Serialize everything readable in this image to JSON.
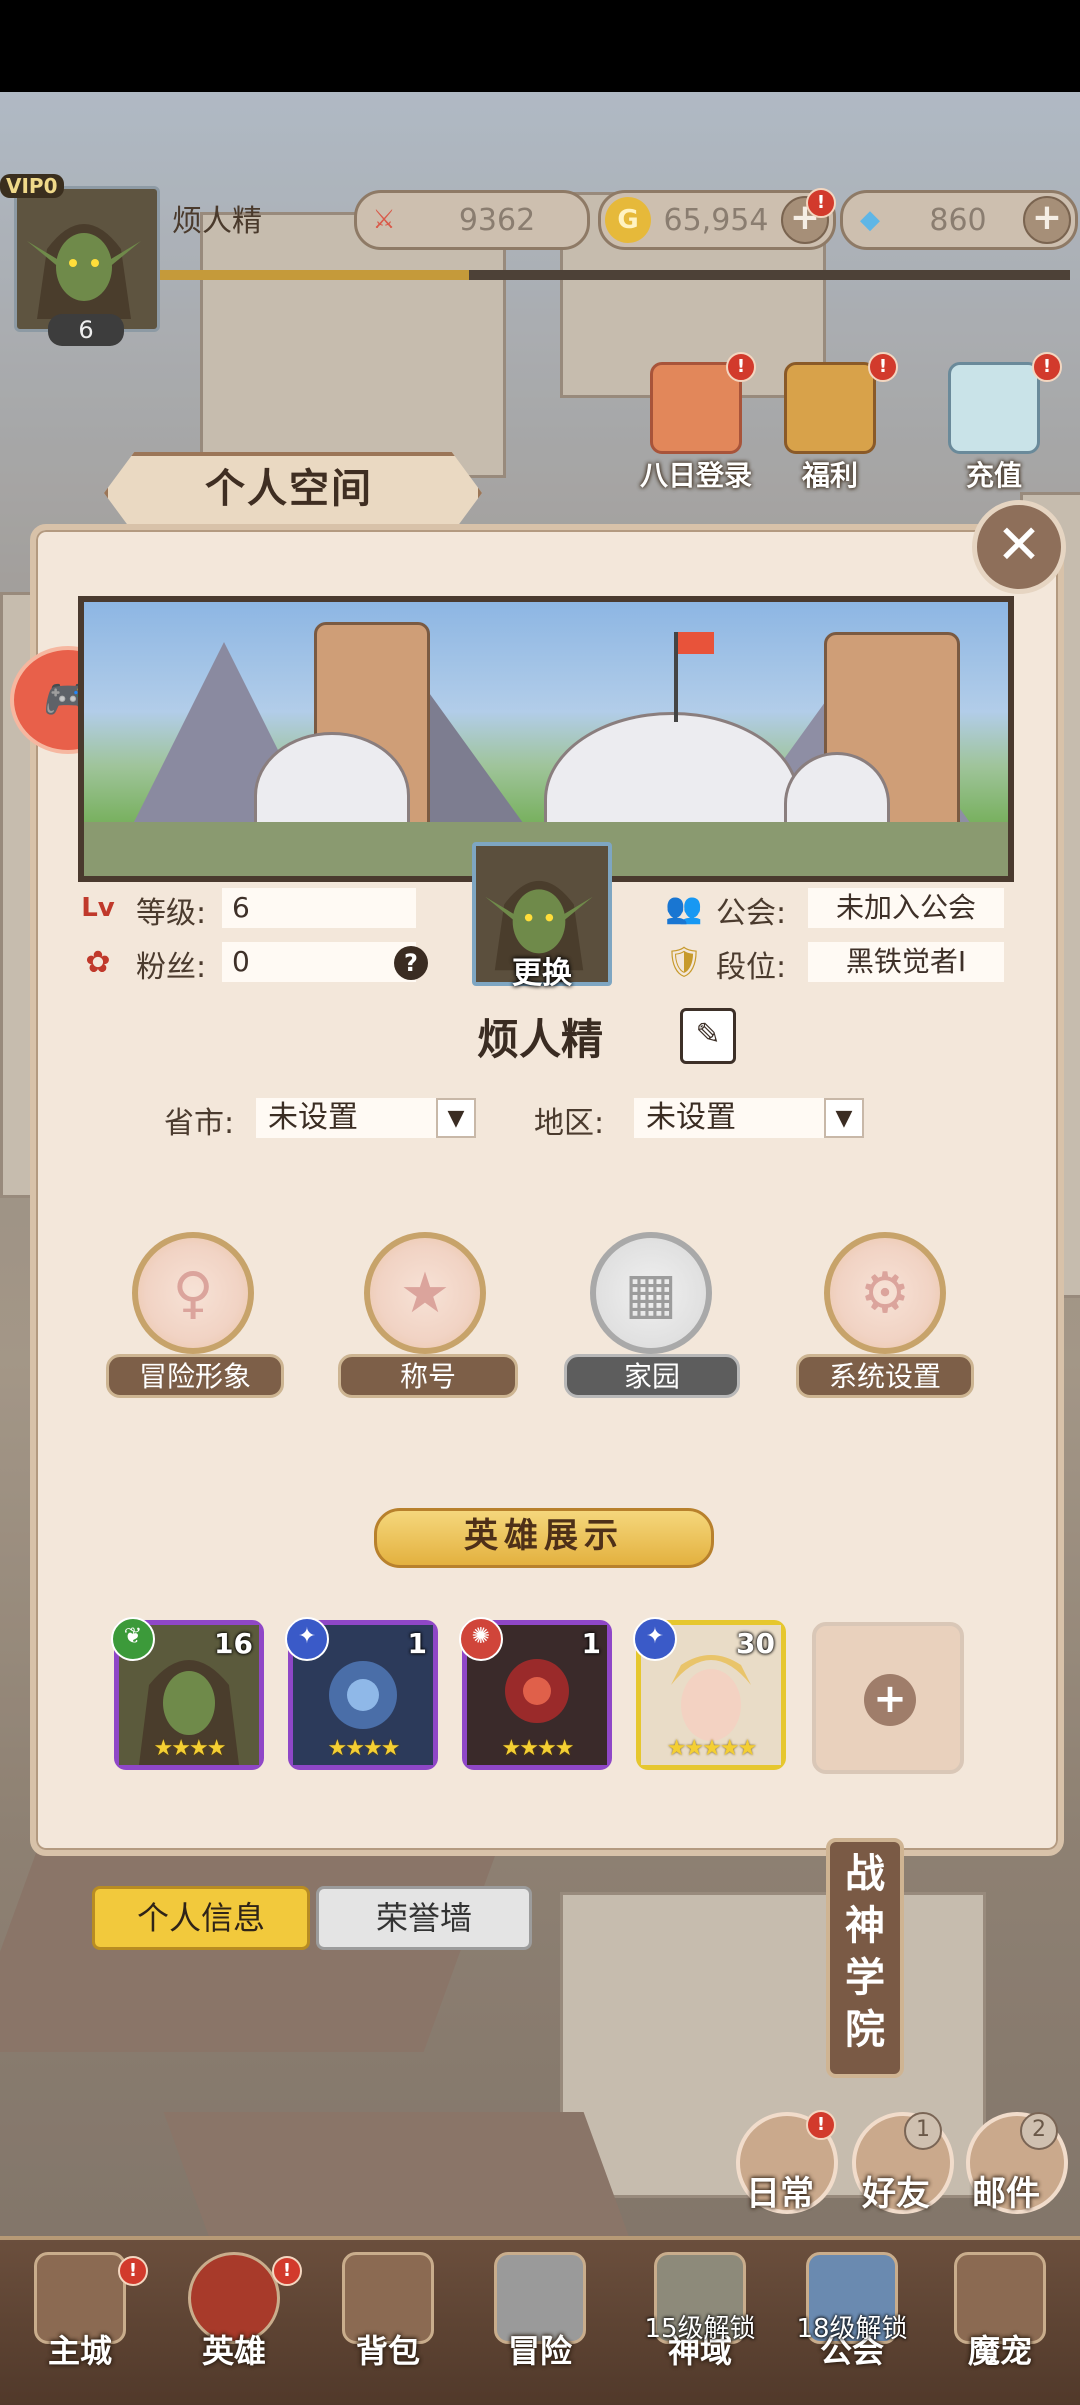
{
  "header": {
    "vip": "VIP0",
    "level": "6",
    "player_name": "烦人精",
    "power": "9362",
    "gold": "65,954",
    "diamond": "860",
    "xp_progress": 0.34
  },
  "events": [
    {
      "label": "八日登录",
      "icon": "calendar-icon"
    },
    {
      "label": "福利",
      "icon": "treasure-chest-icon"
    },
    {
      "label": "充值",
      "icon": "gem-wing-icon"
    }
  ],
  "panel": {
    "title": "个人空间",
    "level_label": "等级:",
    "level_value": "6",
    "fans_label": "粉丝:",
    "fans_value": "0",
    "guild_label": "公会:",
    "guild_value": "未加入公会",
    "rank_label": "段位:",
    "rank_value": "黑铁觉者Ⅰ",
    "change_label": "更换",
    "name": "烦人精",
    "province_label": "省市:",
    "province_value": "未设置",
    "region_label": "地区:",
    "region_value": "未设置",
    "menu": [
      {
        "label": "冒险形象",
        "icon": "adventure-figure-icon"
      },
      {
        "label": "称号",
        "icon": "title-star-icon"
      },
      {
        "label": "家园",
        "icon": "gift-box-icon"
      },
      {
        "label": "系统设置",
        "icon": "gear-icon"
      }
    ],
    "hero_showcase_title": "英雄展示",
    "heroes": [
      {
        "count": "16",
        "stars": "★★★★",
        "element": "nature"
      },
      {
        "count": "1",
        "stars": "★★★★",
        "element": "water"
      },
      {
        "count": "1",
        "stars": "★★★★",
        "element": "fire"
      },
      {
        "count": "30",
        "stars": "★★★★★",
        "element": "water"
      }
    ]
  },
  "tabs": {
    "personal_info": "个人信息",
    "honor_wall": "荣誉墙"
  },
  "side": {
    "academy": "战神学院",
    "daily": "日常",
    "friends": "好友",
    "friends_count": "1",
    "mail": "邮件",
    "mail_count": "2"
  },
  "bottom_nav": [
    {
      "label": "主城",
      "lock": ""
    },
    {
      "label": "英雄",
      "lock": ""
    },
    {
      "label": "背包",
      "lock": ""
    },
    {
      "label": "冒险",
      "lock": ""
    },
    {
      "label": "神域",
      "lock": "15级解锁"
    },
    {
      "label": "公会",
      "lock": "18级解锁"
    },
    {
      "label": "魔宠",
      "lock": ""
    }
  ],
  "colors": {
    "panel_bg": "#f3e7da",
    "accent_gold": "#f2c93c",
    "badge_red": "#d23a2c",
    "hero_frame_purple": "#8f47c7",
    "hero_frame_gold": "#e6c72e"
  }
}
